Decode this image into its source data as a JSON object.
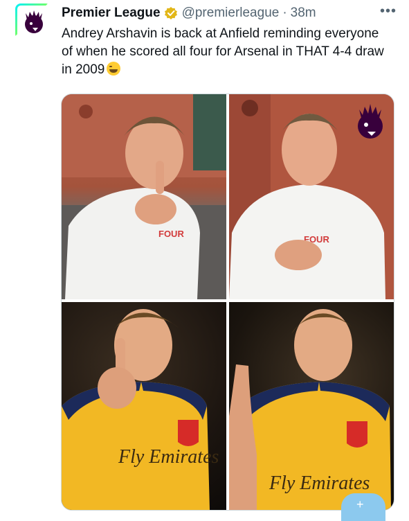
{
  "tweet": {
    "author_name": "Premier League",
    "handle": "@premierleague",
    "separator": "·",
    "time": "38m",
    "more_label": "•••",
    "text": "Andrey Arshavin is back at Anfield reminding everyone of when he scored all four for Arsenal in THAT 4-4 draw in 2009",
    "emoji": "tears-of-joy-emoji",
    "verified_icon": "gold-check-badge-icon",
    "avatar_icon": "premier-league-lion-icon"
  },
  "media": {
    "photos": [
      {
        "shirt_text": "FOUR"
      },
      {
        "shirt_text": "FOUR"
      },
      {
        "shirt_text": "Fly Emirates"
      },
      {
        "shirt_text": "Fly Emirates"
      }
    ],
    "watermark_icon": "premier-league-lion-icon"
  },
  "colors": {
    "text": "#0f1419",
    "muted": "#536471",
    "pl_purple": "#38003c",
    "verified_gold": "#e2b719",
    "arsenal_yellow": "#f2b824"
  }
}
